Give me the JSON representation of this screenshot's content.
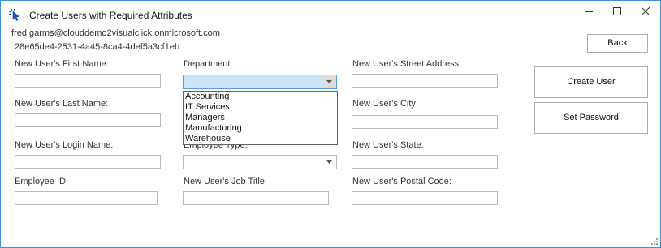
{
  "window": {
    "title": "Create Users with Required Attributes",
    "account_email": "fred.garms@clouddemo2visualclick.onmicrosoft.com",
    "tenant_id": "28e65de4-2531-4a45-8ca4-4def5a3cf1eb"
  },
  "form": {
    "first_name_label": "New User's First Name:",
    "last_name_label": "New User's Last Name:",
    "login_name_label": "New User's Login Name:",
    "employee_id_label": "Employee ID:",
    "department_label": "Department:",
    "employee_type_label": "Employee Type:",
    "job_title_label": "New User's Job Title:",
    "street_label": "New User's Street Address:",
    "city_label": "New User's City:",
    "state_label": "New User's State:",
    "postal_label": "New User's Postal Code:"
  },
  "department_options": [
    "Accounting",
    "IT Services",
    "Managers",
    "Manufacturing",
    "Warehouse"
  ],
  "buttons": {
    "back": "Back",
    "create_user": "Create User",
    "set_password": "Set Password"
  },
  "colors": {
    "window_border": "#3d8ed9",
    "focus_border": "#569de5",
    "focus_fill": "#cce4f7"
  }
}
